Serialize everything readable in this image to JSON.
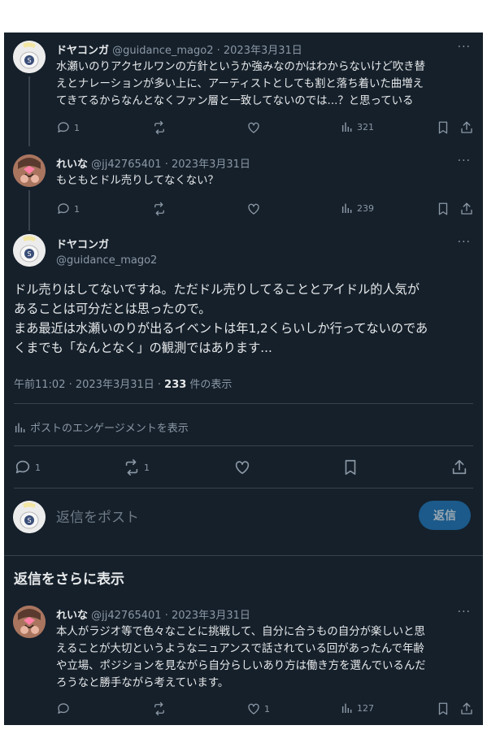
{
  "tweets": {
    "t1": {
      "name": "ドヤコンガ",
      "handle": "@guidance_mago2",
      "sep": "·",
      "date": "2023年3月31日",
      "lines": [
        "水瀬いのりアクセルワンの方針というか強みなのかはわからないけど吹き替",
        "えとナレーションが多い上に、アーティストとしても割と落ち着いた曲増え",
        "てきてるからなんとなくファン層と一致してないのでは...？と思っている"
      ],
      "reply_count": "1",
      "views": "321"
    },
    "t2": {
      "name": "れいな",
      "handle": "@jj42765401",
      "sep": "·",
      "date": "2023年3月31日",
      "lines": [
        "もともとドル売りしてなくない？"
      ],
      "reply_count": "1",
      "views": "239"
    },
    "main": {
      "name": "ドヤコンガ",
      "handle": "@guidance_mago2",
      "lines": [
        "ドル売りはしてないですね。ただドル売りしてることとアイドル的人気が",
        "あることは可分だとは思ったので。",
        "まあ最近は水瀬いのりが出るイベントは年1,2くらいしか行ってないのであ",
        "くまでも「なんとなく」の観測ではあります..."
      ],
      "time": "午前11:02 · 2023年3月31日 · ",
      "view_count": "233",
      "view_suffix": " 件の表示",
      "engagement_link": "ポストのエンゲージメントを表示",
      "reply_count": "1",
      "retweet_count": "1"
    },
    "t4": {
      "name": "れいな",
      "handle": "@jj42765401",
      "sep": "·",
      "date": "2023年3月31日",
      "lines": [
        "本人がラジオ等で色々なことに挑戦して、自分に合うもの自分が楽しいと思",
        "えることが大切というようなニュアンスで話されている回があったんで年齢",
        "や立場、ポジションを見ながら自分らしいあり方は働き方を選んでいるんだ",
        "ろうなと勝手ながら考えています。"
      ],
      "like_count": "1",
      "views": "127"
    }
  },
  "composer": {
    "placeholder": "返信をポスト",
    "button_label": "返信"
  },
  "more_replies": "返信をさらに表示",
  "more_icon": "···",
  "colors": {
    "background": "#15202b",
    "text": "#e7e9ea",
    "muted": "#8b98a5",
    "accent": "#1d9bf0",
    "divider": "#38444d"
  }
}
